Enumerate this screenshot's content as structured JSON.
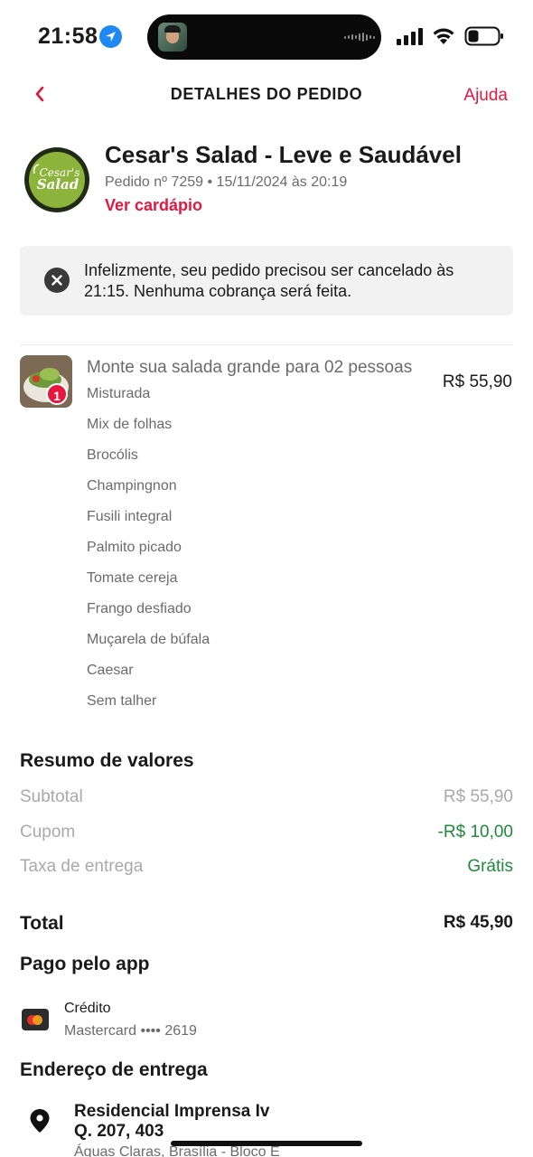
{
  "status_bar": {
    "time": "21:58"
  },
  "header": {
    "title": "DETALHES DO PEDIDO",
    "help_label": "Ajuda"
  },
  "restaurant": {
    "name": "Cesar's Salad - Leve e Saudável",
    "order_info": "Pedido nº 7259 • 15/11/2024 às 20:19",
    "menu_link": "Ver cardápio",
    "logo_text_1": "Cesar's",
    "logo_text_2": "Salad"
  },
  "notice": {
    "text": "Infelizmente, seu pedido precisou ser cancelado às 21:15. Nenhuma cobrança será feita."
  },
  "item": {
    "quantity": "1",
    "name": "Monte sua salada grande para 02 pessoas",
    "price": "R$ 55,90",
    "options": [
      "Misturada",
      "Mix de folhas",
      "Brocólis",
      "Champingnon",
      "Fusili integral",
      "Palmito picado",
      "Tomate cereja",
      "Frango desfiado",
      "Muçarela de búfala",
      "Caesar",
      "Sem talher"
    ]
  },
  "summary": {
    "title": "Resumo de valores",
    "subtotal_label": "Subtotal",
    "subtotal_value": "R$ 55,90",
    "coupon_label": "Cupom",
    "coupon_value": "-R$ 10,00",
    "delivery_label": "Taxa de entrega",
    "delivery_value": "Grátis",
    "total_label": "Total",
    "total_value": "R$ 45,90",
    "green_color": "#1f8a3b"
  },
  "payment": {
    "title": "Pago pelo app",
    "type": "Crédito",
    "card": "Mastercard •••• 2619"
  },
  "address": {
    "title": "Endereço de entrega",
    "line1": "Residencial Imprensa Iv",
    "line2": "Q. 207, 403",
    "line3": "Águas Claras, Brasília - Bloco E"
  },
  "colors": {
    "accent": "#e5173f"
  }
}
